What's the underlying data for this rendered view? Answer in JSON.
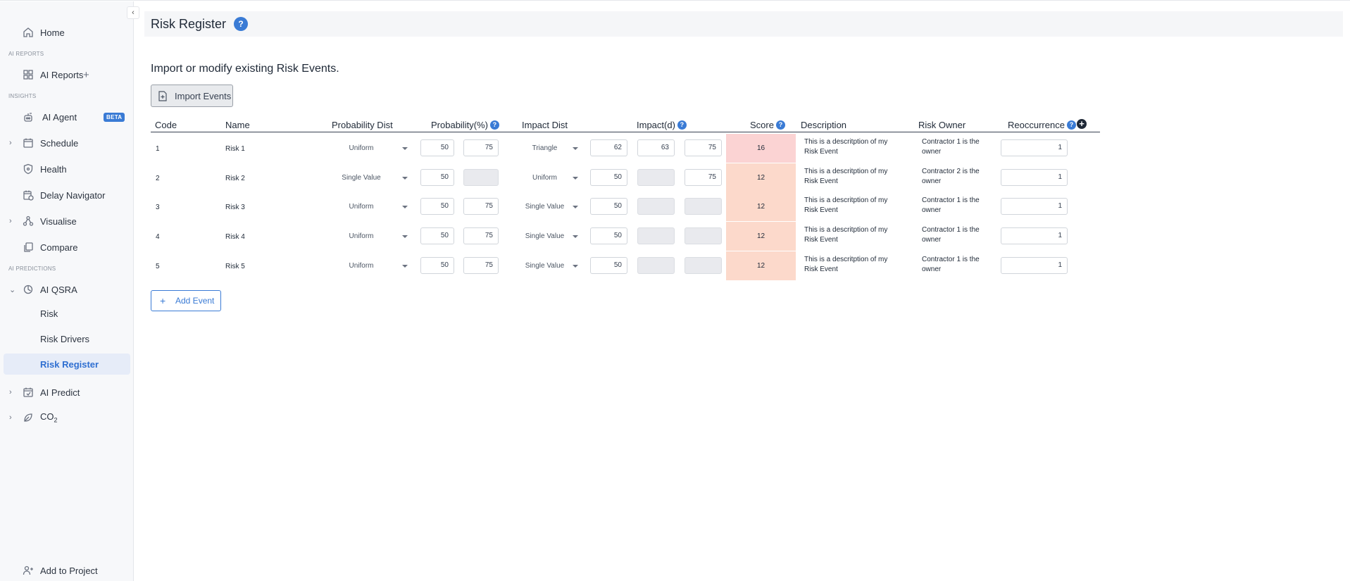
{
  "sidebar": {
    "collapse_icon": "‹",
    "home": "Home",
    "section_ai_reports": "AI REPORTS",
    "ai_reports": "AI Reports",
    "add_report_icon": "+",
    "section_insights": "INSIGHTS",
    "ai_agent": "AI Agent",
    "beta_badge": "BETA",
    "schedule": "Schedule",
    "health": "Health",
    "delay_navigator": "Delay Navigator",
    "visualise": "Visualise",
    "compare": "Compare",
    "section_ai_predictions": "AI PREDICTIONS",
    "ai_qsra": "AI QSRA",
    "risk": "Risk",
    "risk_drivers": "Risk Drivers",
    "risk_register": "Risk Register",
    "ai_predict": "AI Predict",
    "co2": "CO",
    "co2_sub": "2",
    "add_to_project": "Add to Project"
  },
  "header": {
    "title": "Risk Register",
    "help_icon": "?"
  },
  "main": {
    "subtitle": "Import or modify existing Risk Events.",
    "import_button": "Import Events",
    "add_event_button": "Add Event",
    "add_event_plus": "+"
  },
  "table": {
    "columns": {
      "code": "Code",
      "name": "Name",
      "probability_dist": "Probability Dist",
      "probability": "Probability(%)",
      "impact_dist": "Impact Dist",
      "impact": "Impact(d)",
      "score": "Score",
      "description": "Description",
      "risk_owner": "Risk Owner",
      "reoccurrence": "Reoccurrence"
    },
    "help_icon": "?",
    "add_column_icon": "+",
    "rows": [
      {
        "code": "1",
        "name": "Risk 1",
        "prob_dist": "Uniform",
        "prob_min": "50",
        "prob_max": "75",
        "impact_dist": "Triangle",
        "impact_min": "62",
        "impact_mode": "63",
        "impact_max": "75",
        "score": "16",
        "description": "This is a descritption of my Risk Event",
        "owner": "Contractor 1 is the owner",
        "reoccurrence": "1"
      },
      {
        "code": "2",
        "name": "Risk 2",
        "prob_dist": "Single Value",
        "prob_min": "50",
        "prob_max": "",
        "impact_dist": "Uniform",
        "impact_min": "50",
        "impact_mode": "",
        "impact_max": "75",
        "score": "12",
        "description": "This is a descritption of my Risk Event",
        "owner": "Contractor 2 is the owner",
        "reoccurrence": "1"
      },
      {
        "code": "3",
        "name": "Risk 3",
        "prob_dist": "Uniform",
        "prob_min": "50",
        "prob_max": "75",
        "impact_dist": "Single Value",
        "impact_min": "50",
        "impact_mode": "",
        "impact_max": "",
        "score": "12",
        "description": "This is a descritption of my Risk Event",
        "owner": "Contractor 1 is the owner",
        "reoccurrence": "1"
      },
      {
        "code": "4",
        "name": "Risk 4",
        "prob_dist": "Uniform",
        "prob_min": "50",
        "prob_max": "75",
        "impact_dist": "Single Value",
        "impact_min": "50",
        "impact_mode": "",
        "impact_max": "",
        "score": "12",
        "description": "This is a descritption of my Risk Event",
        "owner": "Contractor 1 is the owner",
        "reoccurrence": "1"
      },
      {
        "code": "5",
        "name": "Risk 5",
        "prob_dist": "Uniform",
        "prob_min": "50",
        "prob_max": "75",
        "impact_dist": "Single Value",
        "impact_min": "50",
        "impact_mode": "",
        "impact_max": "",
        "score": "12",
        "description": "This is a descritption of my Risk Event",
        "owner": "Contractor 1 is the owner",
        "reoccurrence": "1"
      }
    ]
  },
  "colors": {
    "accent": "#3a7bd5",
    "score_high": "#fbd3d3",
    "score_medium": "#fcd9cb",
    "active_nav_bg": "#e6ecf8"
  }
}
